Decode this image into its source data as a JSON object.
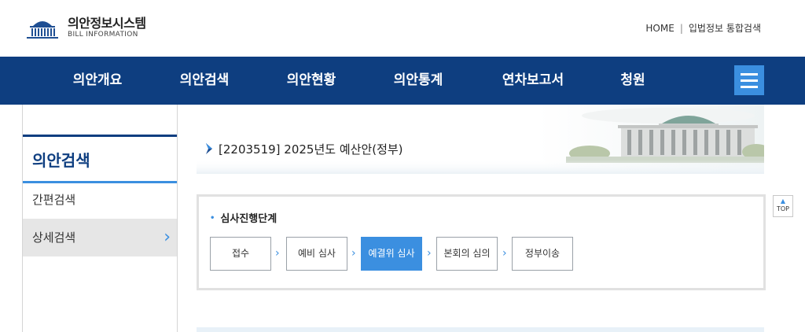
{
  "header": {
    "logo_title": "의안정보시스템",
    "logo_subtitle": "BILL INFORMATION",
    "util_links": [
      "HOME",
      "입법정보 통합검색"
    ],
    "util_separator": "|"
  },
  "nav": {
    "items": [
      "의안개요",
      "의안검색",
      "의안현황",
      "의안통계",
      "연차보고서",
      "청원"
    ],
    "menu_icon": "hamburger-menu-icon"
  },
  "sidebar": {
    "title": "의안검색",
    "items": [
      {
        "label": "간편검색",
        "active": false
      },
      {
        "label": "상세검색",
        "active": true
      }
    ],
    "chevron": "›"
  },
  "bill": {
    "title": "[2203519] 2025년도 예산안(정부)"
  },
  "stages": {
    "label": "심사진행단계",
    "bullet": "•",
    "steps": [
      {
        "label": "접수",
        "active": false
      },
      {
        "label": "예비 심사",
        "active": false
      },
      {
        "label": "예결위 심사",
        "active": true
      },
      {
        "label": "본회의 심의",
        "active": false
      },
      {
        "label": "정부이송",
        "active": false
      }
    ],
    "arrow": "›"
  },
  "top_button": {
    "label": "TOP",
    "arrow": "▲"
  },
  "colors": {
    "nav_bg": "#0e3e80",
    "accent": "#3b8fe0",
    "sidebar_active_bg": "#e6e6e6"
  }
}
